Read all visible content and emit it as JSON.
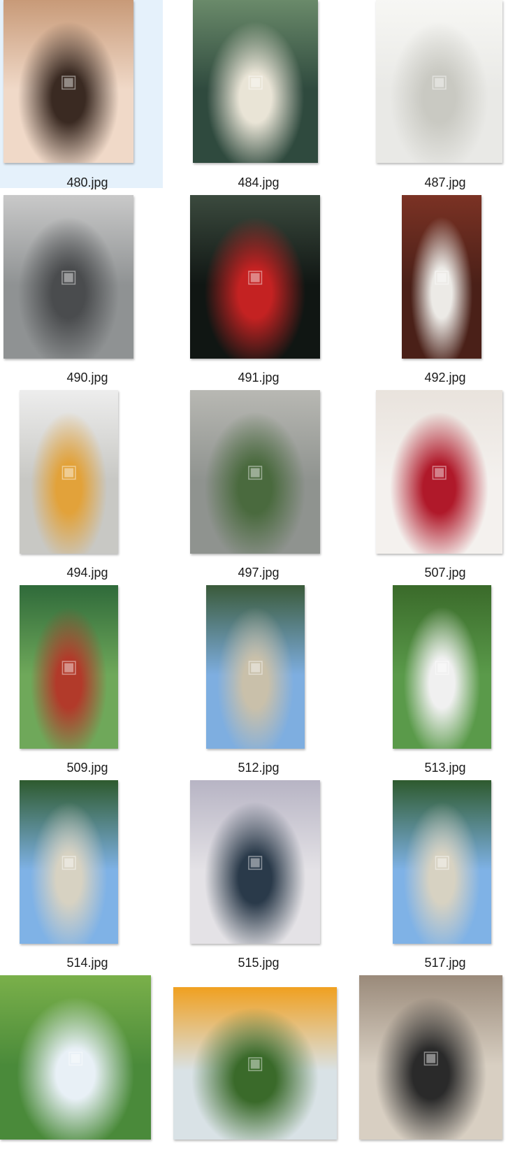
{
  "window": {
    "background": "#ffffff",
    "selection_color": "#e5f1fb"
  },
  "files": [
    {
      "name": "480.jpg",
      "selected": true,
      "icon": "image-thumbnail-icon",
      "colors": [
        "#f0d9c8",
        "#3a2a22",
        "#c89a78"
      ]
    },
    {
      "name": "484.jpg",
      "selected": false,
      "icon": "image-thumbnail-icon",
      "colors": [
        "#2f4a3e",
        "#e9e4d6",
        "#6a8a6a"
      ]
    },
    {
      "name": "487.jpg",
      "selected": false,
      "icon": "image-thumbnail-icon",
      "colors": [
        "#e9e9e6",
        "#c9c9c2",
        "#f7f7f4"
      ]
    },
    {
      "name": "490.jpg",
      "selected": false,
      "icon": "image-thumbnail-icon",
      "colors": [
        "#8f9293",
        "#4a4c4e",
        "#c9c9c9"
      ]
    },
    {
      "name": "491.jpg",
      "selected": false,
      "icon": "image-thumbnail-icon",
      "colors": [
        "#101613",
        "#c42222",
        "#3b4a3e"
      ]
    },
    {
      "name": "492.jpg",
      "selected": false,
      "icon": "image-thumbnail-icon",
      "colors": [
        "#4a2018",
        "#eceae6",
        "#7b3224"
      ]
    },
    {
      "name": "494.jpg",
      "selected": false,
      "icon": "image-thumbnail-icon",
      "colors": [
        "#c8c8c4",
        "#e2a23a",
        "#ededed"
      ]
    },
    {
      "name": "497.jpg",
      "selected": false,
      "icon": "image-thumbnail-icon",
      "colors": [
        "#8f938f",
        "#4a6a3e",
        "#b8b8b3"
      ]
    },
    {
      "name": "507.jpg",
      "selected": false,
      "icon": "image-thumbnail-icon",
      "colors": [
        "#f4f1ee",
        "#b0192a",
        "#e9e3dd"
      ]
    },
    {
      "name": "509.jpg",
      "selected": false,
      "icon": "image-thumbnail-icon",
      "colors": [
        "#6fa85a",
        "#b23a2a",
        "#2f6a3a"
      ]
    },
    {
      "name": "512.jpg",
      "selected": false,
      "icon": "image-thumbnail-icon",
      "colors": [
        "#7eaee0",
        "#c9c0aa",
        "#3a5a3a"
      ]
    },
    {
      "name": "513.jpg",
      "selected": false,
      "icon": "image-thumbnail-icon",
      "colors": [
        "#5a9a4a",
        "#f0f0f0",
        "#3a6a2a"
      ]
    },
    {
      "name": "514.jpg",
      "selected": false,
      "icon": "image-thumbnail-icon",
      "colors": [
        "#7fb2e6",
        "#d7d2c2",
        "#2e5a2e"
      ]
    },
    {
      "name": "515.jpg",
      "selected": false,
      "icon": "image-thumbnail-icon",
      "colors": [
        "#e4e2e6",
        "#2a3a4a",
        "#b7b4c4"
      ]
    },
    {
      "name": "517.jpg",
      "selected": false,
      "icon": "image-thumbnail-icon",
      "colors": [
        "#7fb2e6",
        "#d7d2c2",
        "#2e5a2e"
      ]
    },
    {
      "name": "",
      "selected": false,
      "icon": "image-thumbnail-icon",
      "colors": [
        "#4a8a3a",
        "#e8f0f6",
        "#7ab04a"
      ]
    },
    {
      "name": "",
      "selected": false,
      "icon": "image-thumbnail-icon",
      "colors": [
        "#d9e2e6",
        "#3a6a2a",
        "#f0a020"
      ]
    },
    {
      "name": "",
      "selected": false,
      "icon": "image-thumbnail-icon",
      "colors": [
        "#d8cfc2",
        "#2a2a2a",
        "#9a8a7a"
      ]
    }
  ]
}
